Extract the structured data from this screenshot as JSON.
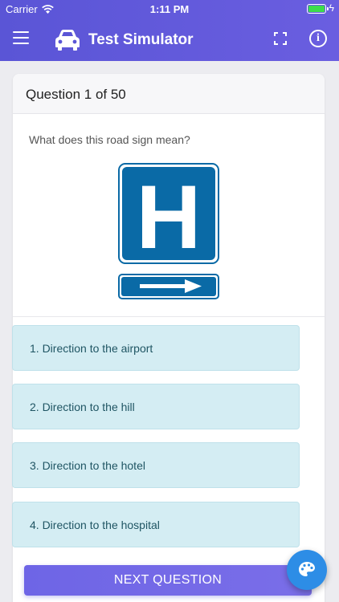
{
  "status_bar": {
    "carrier": "Carrier",
    "time": "1:11 PM",
    "battery_level": 1.0,
    "battery_color": "#3ddc4b"
  },
  "nav": {
    "title": "Test Simulator",
    "menu_icon": "hamburger-menu-icon",
    "car_icon": "car-icon",
    "fullscreen_icon": "fullscreen-icon",
    "info_label": "i",
    "background": "#5a55d6"
  },
  "card": {
    "header": "Question 1 of 50",
    "question": "What does this road sign mean?",
    "sign": {
      "letter": "H",
      "color": "#0a6aa6",
      "arrow_icon": "right-arrow-icon"
    },
    "options": [
      {
        "label": "1. Direction to the airport"
      },
      {
        "label": "2. Direction to the hill"
      },
      {
        "label": "3. Direction to the hotel"
      },
      {
        "label": "4. Direction to the hospital"
      }
    ]
  },
  "next_button": "NEXT QUESTION",
  "fab_icon": "palette-icon",
  "colors": {
    "option_bg": "#d4edf3",
    "option_text": "#1f5563",
    "fab": "#2d8de6"
  }
}
